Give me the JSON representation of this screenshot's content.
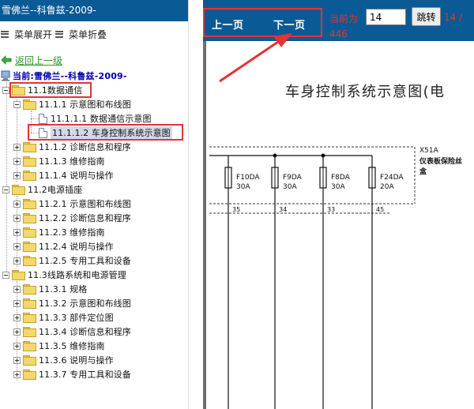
{
  "app": {
    "title": "雪佛兰--科鲁兹-2009-"
  },
  "menu": {
    "expand_label": "菜单展开",
    "collapse_label": "菜单折叠"
  },
  "back_link": "返回上一级",
  "current_location": "当前:雪佛兰--科鲁兹-2009-",
  "tree": {
    "n_11_1": "11.1数据通信",
    "n_11_1_1": "11.1.1 示意图和布线图",
    "n_11_1_1_1": "11.1.1.1 数据通信示意图",
    "n_11_1_1_2": "11.1.1.2 车身控制系统示意图",
    "n_11_1_2": "11.1.2 诊断信息和程序",
    "n_11_1_3": "11.1.3 维修指南",
    "n_11_1_4": "11.1.4 说明与操作",
    "n_11_2": "11.2电源插座",
    "n_11_2_1": "11.2.1 示意图和布线图",
    "n_11_2_2": "11.2.2 诊断信息和程序",
    "n_11_2_3": "11.2.3 维修指南",
    "n_11_2_4": "11.2.4 说明与操作",
    "n_11_2_5": "11.2.5 专用工具和设备",
    "n_11_3": "11.3线路系统和电源管理",
    "n_11_3_1": "11.3.1 规格",
    "n_11_3_2": "11.3.2 示意图和布线图",
    "n_11_3_3": "11.3.3 部件定位图",
    "n_11_3_4": "11.3.4 诊断信息和程序",
    "n_11_3_5": "11.3.5 维修指南",
    "n_11_3_6": "11.3.6 说明与操作",
    "n_11_3_7": "11.3.7 专用工具和设备"
  },
  "viewer": {
    "prev_label": "上一页",
    "next_label": "下一页",
    "current_label": "当前为",
    "page_value": "14",
    "goto_label": "跳转",
    "page_total_a": "14 /",
    "page_total_b": "446"
  },
  "document": {
    "title": "车身控制系统示意图(电",
    "block_label": "X51A",
    "block_name_1": "仪表板保险丝",
    "block_name_2": "盒",
    "fuses": [
      {
        "id": "F10DA",
        "rating": "30A",
        "pin": "35"
      },
      {
        "id": "F9DA",
        "rating": "30A",
        "pin": "34"
      },
      {
        "id": "F8DA",
        "rating": "30A",
        "pin": "33"
      },
      {
        "id": "F24DA",
        "rating": "20A",
        "pin": "45"
      }
    ]
  },
  "colors": {
    "toolbar_bg": "#0a5a96",
    "annotation_red": "#e53333",
    "current_text": "#0000aa",
    "back_link": "#2a9a2a"
  }
}
